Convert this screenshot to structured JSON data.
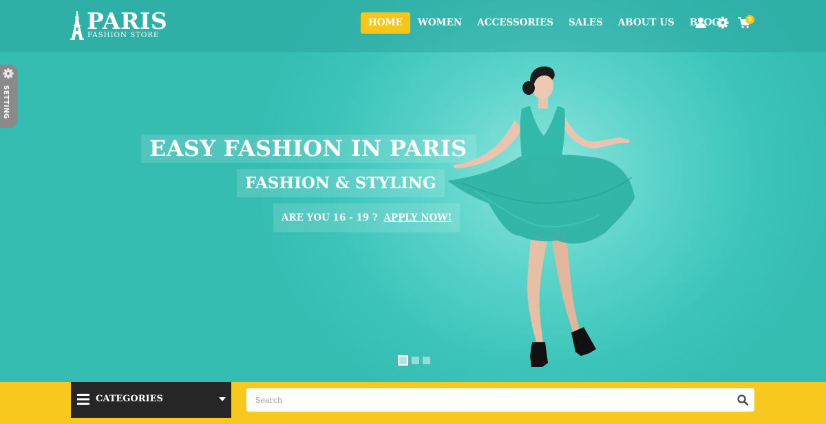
{
  "brand": {
    "name": "PARIS",
    "tagline": "FASHION STORE"
  },
  "nav": {
    "items": [
      {
        "label": "HOME",
        "active": true
      },
      {
        "label": "WOMEN",
        "active": false
      },
      {
        "label": "ACCESSORIES",
        "active": false
      },
      {
        "label": "SALES",
        "active": false
      },
      {
        "label": "ABOUT US",
        "active": false
      },
      {
        "label": "BLOG",
        "active": false
      }
    ],
    "icons": [
      "user-icon",
      "gear-icon",
      "cart-icon"
    ],
    "cart_count": "0"
  },
  "setting_tab": {
    "label": "SETTING",
    "icon": "gear-icon"
  },
  "hero": {
    "headline": "EASY FASHION IN PARIS",
    "subheadline": "FASHION & STYLING",
    "cta_prefix": "ARE YOU 16 - 19 ?",
    "cta_link": "APPLY NOW!",
    "slides_total": 3,
    "slide_active": 1
  },
  "categories": {
    "label": "CATEGORIES",
    "icon": "hamburger-icon"
  },
  "search": {
    "placeholder": "Search",
    "icon": "search-icon"
  },
  "colors": {
    "accent": "#f6c619",
    "hero_teal": "#3cc4b9",
    "dark": "#262626"
  }
}
